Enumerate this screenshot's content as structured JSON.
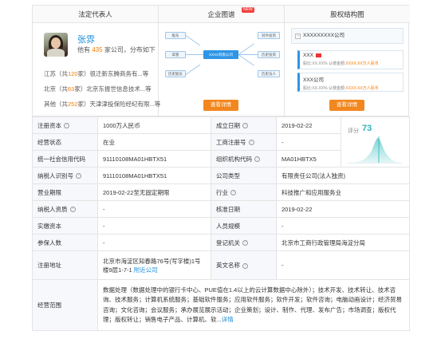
{
  "panels": {
    "legal_rep_title": "法定代表人",
    "graph_title": "企业图谱",
    "graph_badge": "NEW",
    "equity_title": "股权结构图"
  },
  "legal_rep": {
    "name": "张雰",
    "sub_prefix": "他有",
    "sub_count": "435",
    "sub_suffix": "家公司，分布如下",
    "regions": [
      {
        "pre": "江苏（共",
        "count": "120",
        "post": "家）很迁新东腾商务有...等"
      },
      {
        "pre": "北京（共",
        "count": "63",
        "post": "家）北京东振世信息技术...等"
      },
      {
        "pre": "其他（共",
        "count": "252",
        "post": "家）天津津投保险经纪有限...等"
      }
    ]
  },
  "graph": {
    "center": "XXXX有限公司",
    "left_nodes": [
      "股东",
      "高管",
      "历史股东"
    ],
    "right_nodes": [
      "对外投资",
      "历史投资",
      "历史法人"
    ],
    "button": "查看详情"
  },
  "equity": {
    "top": "XXXXXXXXX公司",
    "items": [
      {
        "name": "XXX",
        "ratio": "股比:XX.XX%",
        "amount_label": "认缴金额:",
        "amount": "XXXX.XX万人民币"
      },
      {
        "name": "XXX公司",
        "ratio": "股比:XX.XX%",
        "amount_label": "认缴金额:",
        "amount": "XXXX.XX万人民币"
      }
    ],
    "button": "查看详情"
  },
  "info": {
    "reg_capital_k": "注册资本",
    "reg_capital_v": "1000万人民币",
    "found_date_k": "成立日期",
    "found_date_v": "2019-02-22",
    "status_k": "经营状态",
    "status_v": "在业",
    "biz_reg_k": "工商注册号",
    "biz_reg_v": "-",
    "credit_code_k": "统一社会信用代码",
    "credit_code_v": "91110108MA01HBTX51",
    "org_code_k": "组织机构代码",
    "org_code_v": "MA01HBTX5",
    "taxpayer_id_k": "纳税人识别号",
    "taxpayer_id_v": "91110108MA01HBTX51",
    "company_type_k": "公司类型",
    "company_type_v": "有限责任公司(法人独资)",
    "term_k": "营业期限",
    "term_v": "2019-02-22至无固定期限",
    "industry_k": "行业",
    "industry_v": "科技推广和应用服务业",
    "tax_quali_k": "纳税人资质",
    "tax_quali_v": "-",
    "approve_date_k": "核准日期",
    "approve_date_v": "2019-02-22",
    "paid_capital_k": "实缴资本",
    "paid_capital_v": "-",
    "staff_k": "人员规模",
    "staff_v": "-",
    "insured_k": "参保人数",
    "insured_v": "-",
    "reg_office_k": "登记机关",
    "reg_office_v": "北京市工商行政管理局海淀分局",
    "address_k": "注册地址",
    "address_v": "北京市海淀区知春路76号(写字楼)1号楼9层1-7-1",
    "address_link": "附近公司",
    "en_name_k": "英文名称",
    "en_name_v": "-",
    "scope_k": "经营范围",
    "scope_v": "数据处理（数据处理中的银行卡中心、PUE值在1.4以上的云计算数据中心除外）；技术开发、技术转让、技术咨询、技术服务；计算机系统服务；基础软件服务；应用软件服务；软件开发；软件咨询；电脑动画设计；经济贸易咨询；文化咨询；会议服务；承办展览展示活动；企业策划；设计、制作、代理、发布广告；市场调查；版权代理；版权转让；销售电子产品、计算机、软...",
    "scope_link": "详情"
  },
  "score": {
    "label": "评分",
    "value": "73"
  },
  "colors": {
    "accent": "#1a8cd8",
    "orange": "#f2871f",
    "score": "#2fb3b8"
  }
}
